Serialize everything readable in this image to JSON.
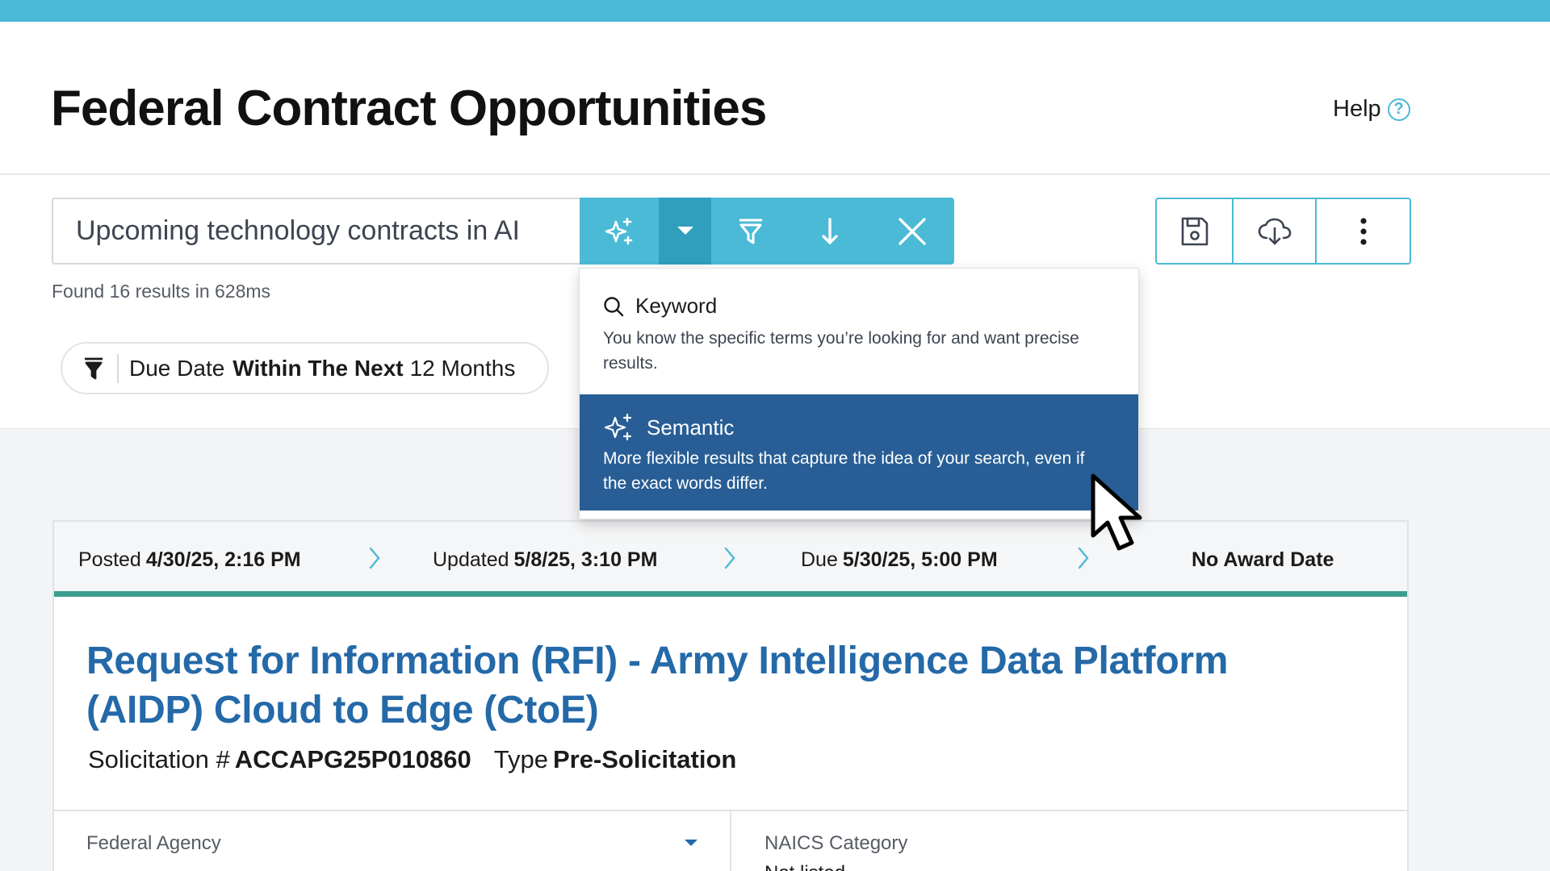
{
  "page": {
    "title": "Federal Contract Opportunities",
    "help_label": "Help",
    "help_icon": "question-circle-icon"
  },
  "search": {
    "value": "Upcoming technology contracts in AI",
    "results_text": "Found 16 results in 628ms",
    "tools": [
      "sparkles-icon",
      "caret-down-icon",
      "filter-icon",
      "sort-down-icon",
      "close-icon"
    ],
    "actions": [
      "save-icon",
      "cloud-download-icon",
      "more-vertical-icon"
    ]
  },
  "filter_chip": {
    "field": "Due Date",
    "operator": "Within The Next",
    "value": "12 Months"
  },
  "search_mode_menu": {
    "options": [
      {
        "label": "Keyword",
        "icon": "search-icon",
        "description": "You know the specific terms you’re looking for and want precise results.",
        "selected": false
      },
      {
        "label": "Semantic",
        "icon": "sparkles-icon",
        "description": "More flexible results that capture the idea of your search, even if the exact words differ.",
        "selected": true
      }
    ]
  },
  "opportunity": {
    "posted_label": "Posted",
    "posted_value": "4/30/25, 2:16 PM",
    "updated_label": "Updated",
    "updated_value": "5/8/25, 3:10 PM",
    "due_label": "Due",
    "due_value": "5/30/25, 5:00 PM",
    "award_text": "No Award Date",
    "title": "Request for Information (RFI) - Army Intelligence Data Platform (AIDP) Cloud to Edge (CtoE)",
    "solicitation_label": "Solicitation #",
    "solicitation_value": "ACCAPG25P010860",
    "type_label": "Type",
    "type_value": "Pre-Solicitation",
    "agency_label": "Federal Agency",
    "naics_label": "NAICS Category",
    "naics_value": "Not listed"
  },
  "colors": {
    "accent": "#4bbad6",
    "selected_option": "#285e95",
    "title_link": "#2469a8",
    "progress_line": "#3d9e8f"
  }
}
